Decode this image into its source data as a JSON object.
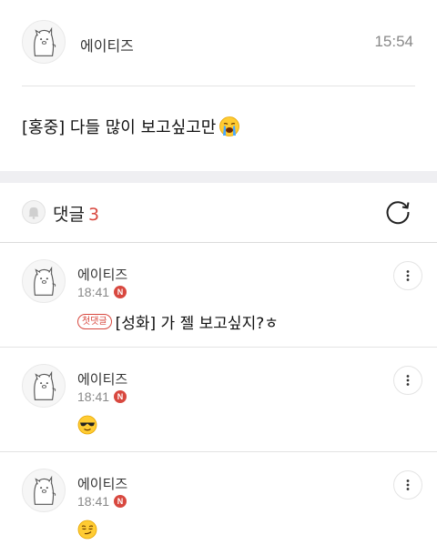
{
  "post": {
    "author": "에이티즈",
    "time": "15:54",
    "body_text": "[홍중] 다들 많이 보고싶고만",
    "body_emoji": "loudly-crying-face-icon"
  },
  "comments_header": {
    "label": "댓글",
    "count": "3"
  },
  "comments": [
    {
      "author": "에이티즈",
      "time": "18:41",
      "badge": "N",
      "first_tag": "첫댓글",
      "text": "[성화] 가 젤 보고싶지?ㅎ"
    },
    {
      "author": "에이티즈",
      "time": "18:41",
      "badge": "N",
      "emoji": "sunglasses-face-icon"
    },
    {
      "author": "에이티즈",
      "time": "18:41",
      "badge": "N",
      "emoji": "smirking-face-icon"
    }
  ],
  "colors": {
    "accent": "#d8483f",
    "divider": "#e3e3e3",
    "section_gap": "#efeff2"
  }
}
